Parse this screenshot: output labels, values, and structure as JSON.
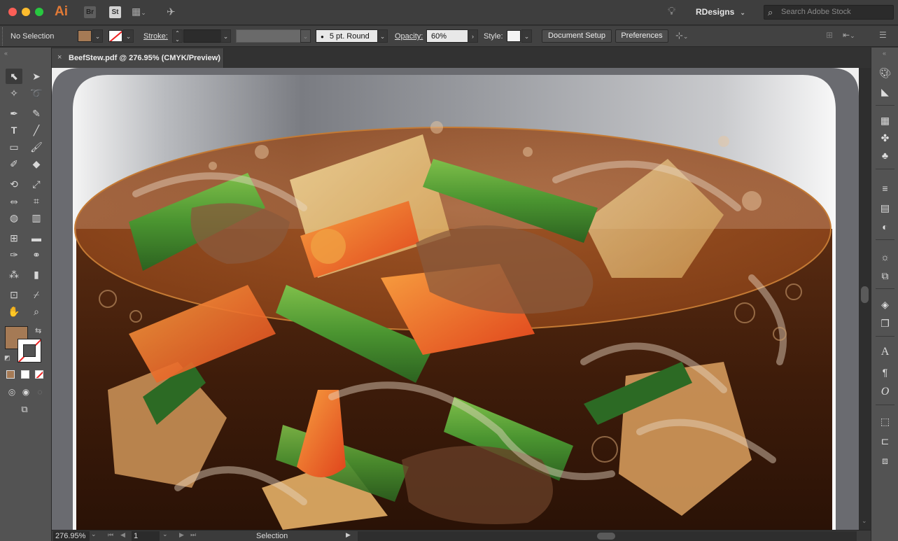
{
  "app": {
    "logo": "Ai",
    "bridge_badge": "Br",
    "stock_badge": "St",
    "workspace": "RDesigns",
    "search_placeholder": "Search Adobe Stock"
  },
  "control_bar": {
    "selection_status": "No Selection",
    "fill_color": "#a57a55",
    "stroke_label": "Stroke:",
    "brush": "5 pt. Round",
    "opacity_label": "Opacity:",
    "opacity_value": "60%",
    "style_label": "Style:",
    "document_setup": "Document Setup",
    "preferences": "Preferences"
  },
  "document_tab": {
    "close": "×",
    "title": "BeefStew.pdf @ 276.95% (CMYK/Preview)"
  },
  "tools": {
    "fill_color": "#a57a55"
  },
  "status_bar": {
    "zoom": "276.95%",
    "artboard": "1",
    "tool": "Selection"
  }
}
